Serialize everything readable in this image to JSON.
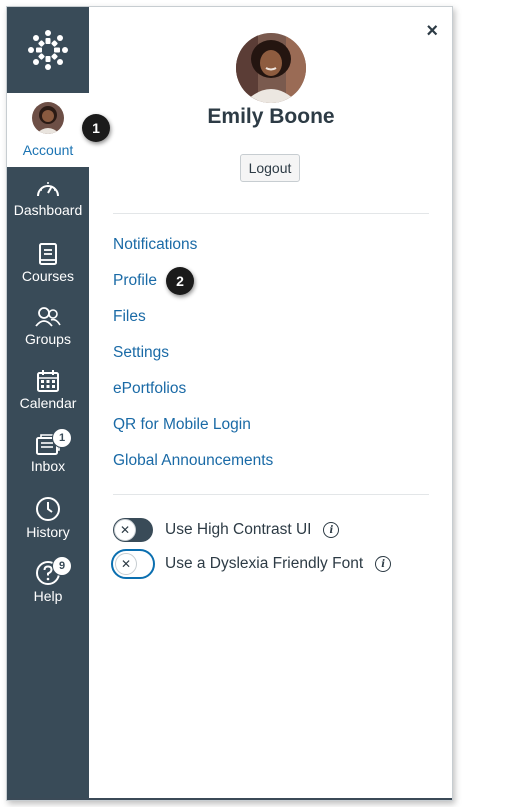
{
  "nav": {
    "account_label": "Account",
    "items": [
      {
        "label": "Dashboard",
        "icon": "dashboard-icon"
      },
      {
        "label": "Courses",
        "icon": "courses-icon"
      },
      {
        "label": "Groups",
        "icon": "groups-icon"
      },
      {
        "label": "Calendar",
        "icon": "calendar-icon"
      },
      {
        "label": "Inbox",
        "icon": "inbox-icon",
        "badge": "1"
      },
      {
        "label": "History",
        "icon": "history-icon"
      },
      {
        "label": "Help",
        "icon": "help-icon",
        "badge": "9"
      }
    ]
  },
  "tray": {
    "close_label": "×",
    "user_name": "Emily Boone",
    "logout_label": "Logout",
    "links": [
      "Notifications",
      "Profile",
      "Files",
      "Settings",
      "ePortfolios",
      "QR for Mobile Login",
      "Global Announcements"
    ],
    "toggles": [
      {
        "label": "Use High Contrast UI",
        "state": "off"
      },
      {
        "label": "Use a Dyslexia Friendly Font",
        "state": "off"
      }
    ]
  },
  "callouts": [
    "1",
    "2"
  ],
  "colors": {
    "nav_bg": "#394b58",
    "link": "#1a6aa6",
    "account_label": "#1c74b3",
    "text": "#2d3b45"
  }
}
